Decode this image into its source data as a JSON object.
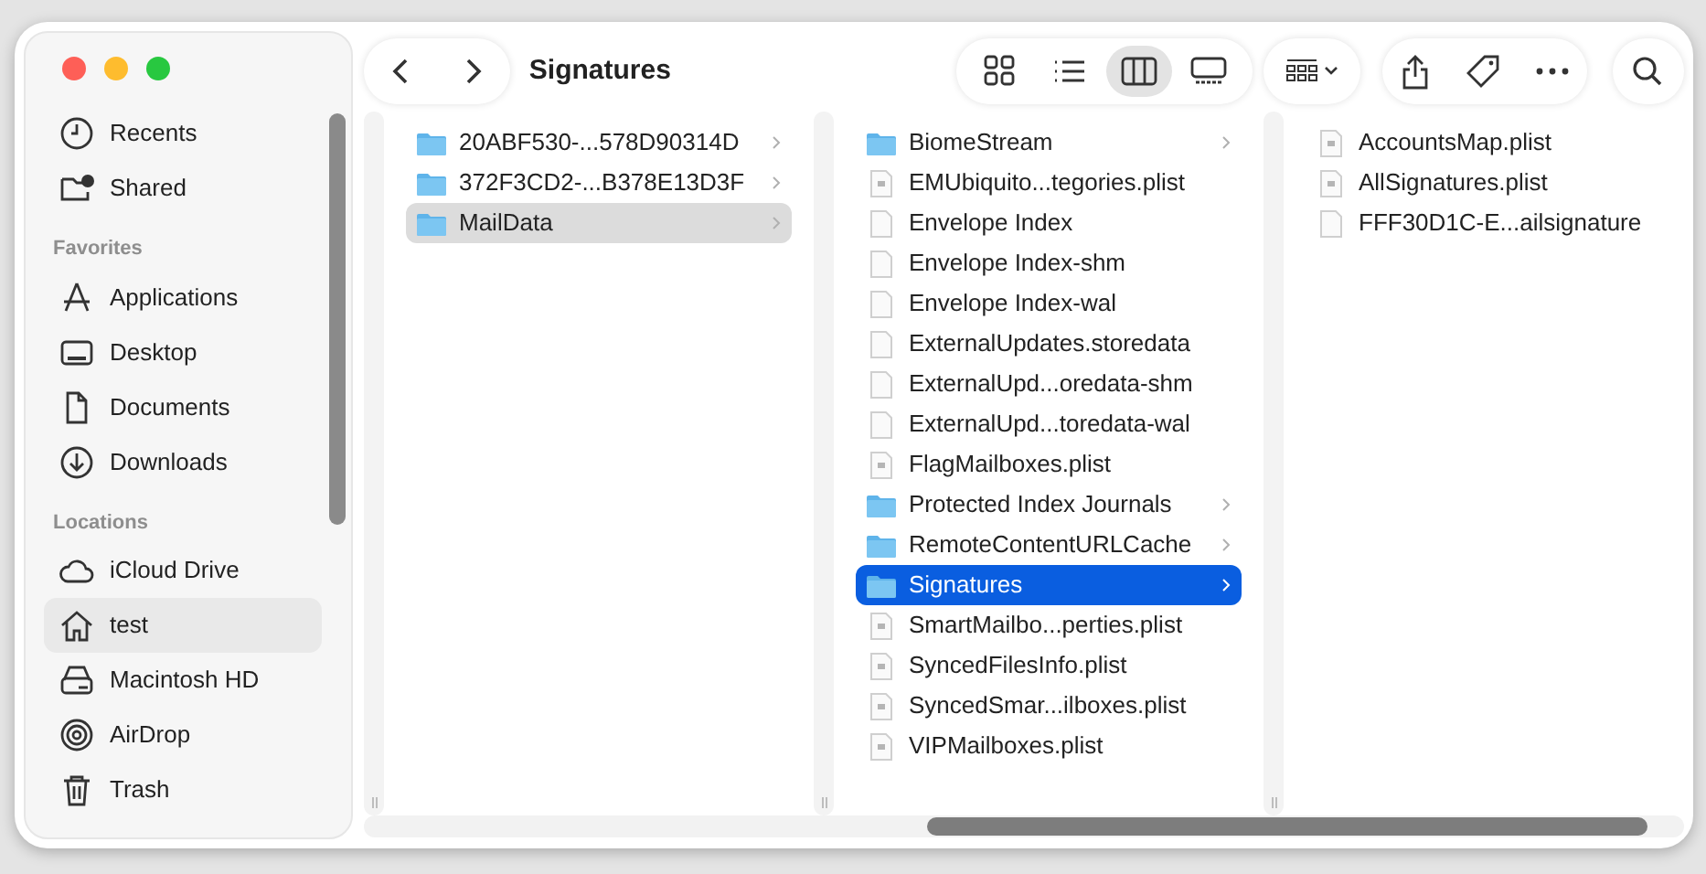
{
  "window": {
    "title": "Signatures"
  },
  "view_modes": [
    {
      "kind": "icons",
      "selected": false
    },
    {
      "kind": "list",
      "selected": false
    },
    {
      "kind": "columns",
      "selected": true
    },
    {
      "kind": "gallery",
      "selected": false
    }
  ],
  "sidebar": {
    "sections": [
      {
        "items": [
          {
            "label": "Recents",
            "kind": "clock",
            "selected": false
          },
          {
            "label": "Shared",
            "kind": "shared",
            "selected": false
          }
        ]
      },
      {
        "heading": "Favorites",
        "items": [
          {
            "label": "Applications",
            "kind": "apps",
            "selected": false
          },
          {
            "label": "Desktop",
            "kind": "desktop",
            "selected": false
          },
          {
            "label": "Documents",
            "kind": "document",
            "selected": false
          },
          {
            "label": "Downloads",
            "kind": "download",
            "selected": false
          }
        ]
      },
      {
        "heading": "Locations",
        "items": [
          {
            "label": "iCloud Drive",
            "kind": "cloud",
            "selected": false
          },
          {
            "label": "test",
            "kind": "home",
            "selected": true
          },
          {
            "label": "Macintosh HD",
            "kind": "drive",
            "selected": false
          },
          {
            "label": "AirDrop",
            "kind": "airdrop",
            "selected": false
          },
          {
            "label": "Trash",
            "kind": "trash",
            "selected": false
          }
        ]
      }
    ]
  },
  "columns": [
    {
      "focused": false,
      "items": [
        {
          "name": "20ABF530-...578D90314D",
          "kind": "folder",
          "selected": false
        },
        {
          "name": "372F3CD2-...B378E13D3F",
          "kind": "folder",
          "selected": false
        },
        {
          "name": "MailData",
          "kind": "folder",
          "selected": true
        }
      ]
    },
    {
      "focused": true,
      "items": [
        {
          "name": "BiomeStream",
          "kind": "folder",
          "selected": false
        },
        {
          "name": "EMUbiquito...tegories.plist",
          "kind": "plist",
          "selected": false
        },
        {
          "name": "Envelope Index",
          "kind": "document",
          "selected": false
        },
        {
          "name": "Envelope Index-shm",
          "kind": "document",
          "selected": false
        },
        {
          "name": "Envelope Index-wal",
          "kind": "document",
          "selected": false
        },
        {
          "name": "ExternalUpdates.storedata",
          "kind": "document",
          "selected": false
        },
        {
          "name": "ExternalUpd...oredata-shm",
          "kind": "document",
          "selected": false
        },
        {
          "name": "ExternalUpd...toredata-wal",
          "kind": "document",
          "selected": false
        },
        {
          "name": "FlagMailboxes.plist",
          "kind": "plist",
          "selected": false
        },
        {
          "name": "Protected Index Journals",
          "kind": "folder",
          "selected": false
        },
        {
          "name": "RemoteContentURLCache",
          "kind": "folder",
          "selected": false
        },
        {
          "name": "Signatures",
          "kind": "folder",
          "selected": true
        },
        {
          "name": "SmartMailbo...perties.plist",
          "kind": "plist",
          "selected": false
        },
        {
          "name": "SyncedFilesInfo.plist",
          "kind": "plist",
          "selected": false
        },
        {
          "name": "SyncedSmar...ilboxes.plist",
          "kind": "plist",
          "selected": false
        },
        {
          "name": "VIPMailboxes.plist",
          "kind": "plist",
          "selected": false
        }
      ]
    },
    {
      "items": [
        {
          "name": "AccountsMap.plist",
          "kind": "plist",
          "selected": false
        },
        {
          "name": "AllSignatures.plist",
          "kind": "plist",
          "selected": false
        },
        {
          "name": "FFF30D1C-E...ailsignature",
          "kind": "document",
          "selected": false
        }
      ]
    }
  ]
}
